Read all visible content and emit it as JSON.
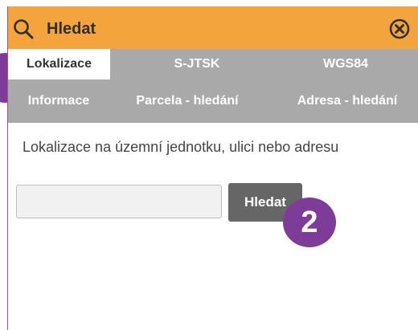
{
  "header": {
    "title": "Hledat",
    "search_icon": "search-icon",
    "close_icon": "close-icon",
    "accent_color": "#f4a43c"
  },
  "tabs": [
    {
      "label": "Lokalizace",
      "active": true
    },
    {
      "label": "S-JTSK",
      "active": false
    },
    {
      "label": "WGS84",
      "active": false
    },
    {
      "label": "Informace",
      "active": false
    },
    {
      "label": "Parcela - hledání",
      "active": false
    },
    {
      "label": "Adresa - hledání",
      "active": false
    }
  ],
  "main": {
    "description": "Lokalizace na územní jednotku, ulici nebo adresu",
    "search": {
      "placeholder": "",
      "value": ""
    },
    "button_label": "Hledat"
  },
  "annotations": {
    "step_badge": "2",
    "badge_color": "#7d3c98"
  }
}
